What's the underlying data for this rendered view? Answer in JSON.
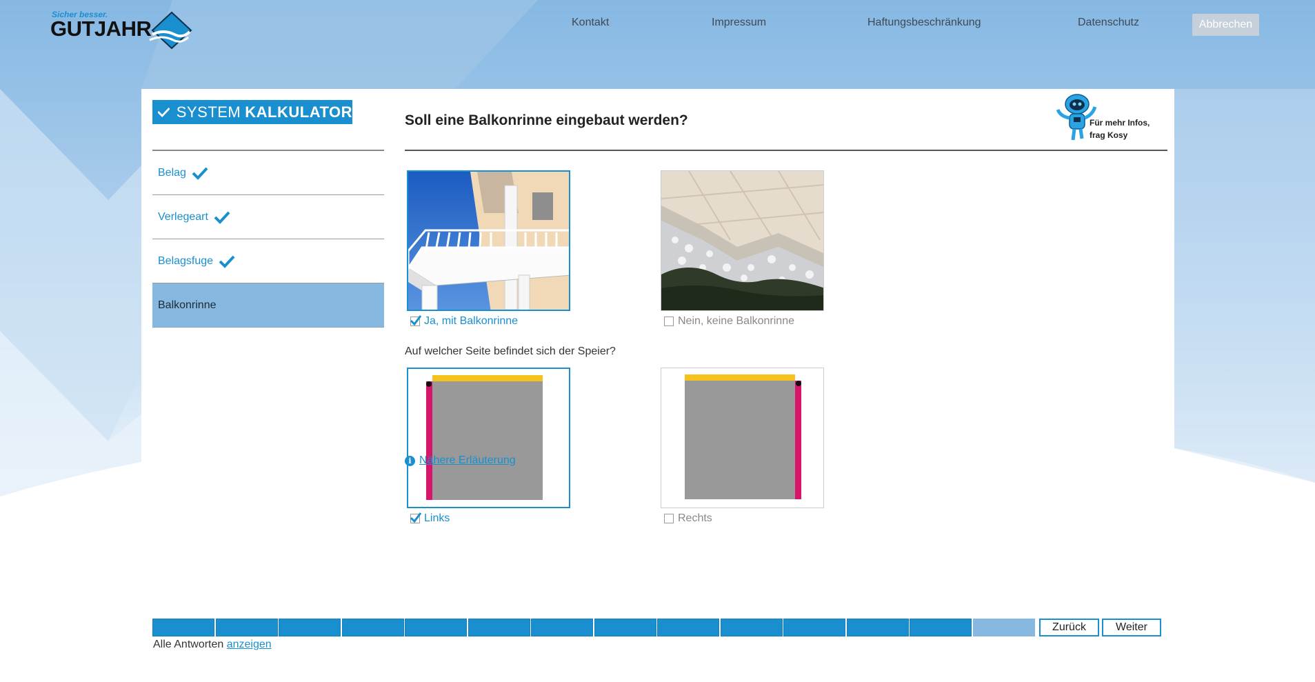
{
  "header": {
    "logo_tagline": "Sicher besser.",
    "logo_name": "GUTJAHR",
    "nav": [
      "Kontakt",
      "Impressum",
      "Haftungsbeschränkung",
      "Datenschutz"
    ],
    "cancel_label": "Abbrechen"
  },
  "brand": {
    "word1": "SYSTEM",
    "word2": "KALKULATOR"
  },
  "sidebar": {
    "items": [
      {
        "label": "Belag",
        "done": true
      },
      {
        "label": "Verlegeart",
        "done": true
      },
      {
        "label": "Belagsfuge",
        "done": true
      },
      {
        "label": "Balkonrinne",
        "active": true
      }
    ]
  },
  "question": {
    "title": "Soll eine Balkonrinne eingebaut werden?",
    "options": [
      {
        "label": "Ja, mit Balkonrinne",
        "checked": true
      },
      {
        "label": "Nein, keine Balkonrinne",
        "checked": false
      }
    ]
  },
  "sub_question": {
    "title": "Auf welcher Seite befindet sich der Speier?",
    "options": [
      {
        "label": "Links",
        "checked": true
      },
      {
        "label": "Rechts",
        "checked": false
      }
    ]
  },
  "info_link": "Nähere Erläuterung",
  "kosy": {
    "line1": "Für mehr Infos,",
    "line2": "frag Kosy"
  },
  "progress": {
    "done_steps": 13,
    "total_steps": 14
  },
  "footer": {
    "back_label": "Zurück",
    "next_label": "Weiter",
    "all_answers_prefix": "Alle Antworten",
    "all_answers_link": "anzeigen"
  },
  "colors": {
    "accent": "#1a8fd0",
    "active_bg": "#87b9e0",
    "yellow": "#f5c21b",
    "magenta": "#d6156b",
    "gray": "#999999"
  }
}
